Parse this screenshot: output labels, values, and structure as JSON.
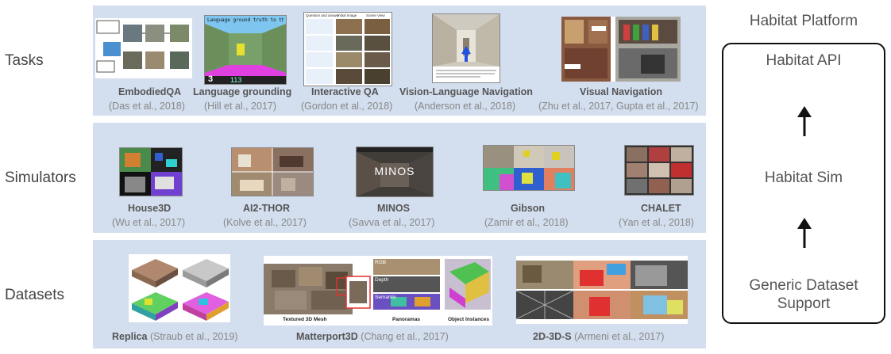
{
  "rows": {
    "tasks": "Tasks",
    "simulators": "Simulators",
    "datasets": "Datasets"
  },
  "tasks": [
    {
      "name": "EmbodiedQA",
      "cite": "(Das et al., 2018)"
    },
    {
      "name": "Language grounding",
      "cite": "(Hill et al., 2017)",
      "thumb_text": "Language ground truth to the green object",
      "score_left": "3",
      "score_right": "113"
    },
    {
      "name": "Interactive QA",
      "cite": "(Gordon et al., 2018)",
      "headers": [
        "Question and answer",
        "Initial Image",
        "Scene View"
      ]
    },
    {
      "name": "Vision-Language Navigation",
      "cite": "(Anderson et al., 2018)"
    },
    {
      "name": "Visual Navigation",
      "cite": "(Zhu et al., 2017, Gupta et al., 2017)"
    }
  ],
  "simulators": [
    {
      "name": "House3D",
      "cite": "(Wu et al., 2017)"
    },
    {
      "name": "AI2-THOR",
      "cite": "(Kolve et al., 2017)"
    },
    {
      "name": "MINOS",
      "cite": "(Savva et al., 2017)",
      "overlay": "MINOS"
    },
    {
      "name": "Gibson",
      "cite": "(Zamir et al., 2018)"
    },
    {
      "name": "CHALET",
      "cite": "(Yan et al., 2018)"
    }
  ],
  "datasets": [
    {
      "name": "Replica",
      "cite": "(Straub et al., 2019)"
    },
    {
      "name": "Matterport3D",
      "cite": "(Chang et al., 2017)",
      "labels": [
        "Textured 3D Mesh",
        "Panoramas",
        "Object Instances",
        "RGB",
        "Depth",
        "Semantic"
      ]
    },
    {
      "name": "2D-3D-S",
      "cite": "(Armeni et al., 2017)"
    }
  ],
  "platform": {
    "title": "Habitat Platform",
    "api": "Habitat API",
    "sim": "Habitat Sim",
    "dataset_line1": "Generic Dataset",
    "dataset_line2": "Support"
  }
}
